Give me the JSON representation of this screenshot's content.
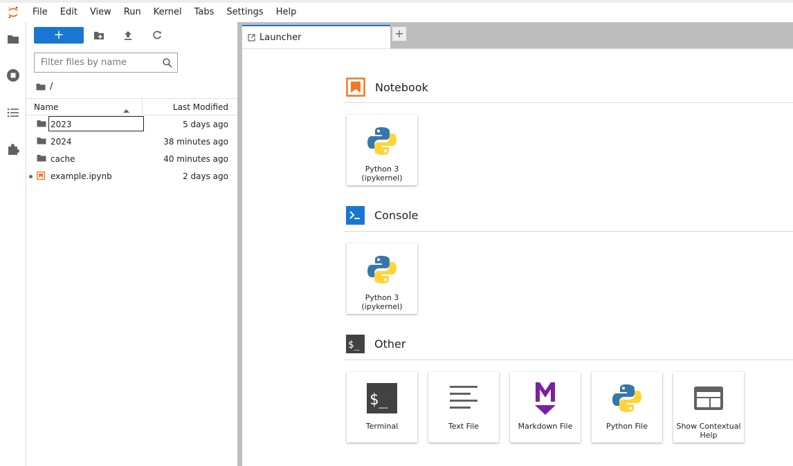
{
  "menubar": {
    "items": [
      "File",
      "Edit",
      "View",
      "Run",
      "Kernel",
      "Tabs",
      "Settings",
      "Help"
    ]
  },
  "activitybar": {
    "icons": [
      "folder-icon",
      "stop-circle-icon",
      "list-icon",
      "puzzle-icon"
    ]
  },
  "filebrowser": {
    "new_button": "+",
    "filter_placeholder": "Filter files by name",
    "breadcrumb": "/",
    "columns": {
      "name": "Name",
      "modified": "Last Modified"
    },
    "rows": [
      {
        "name": "2023",
        "modified": "5 days ago",
        "type": "folder",
        "editing": true
      },
      {
        "name": "2024",
        "modified": "38 minutes ago",
        "type": "folder"
      },
      {
        "name": "cache",
        "modified": "40 minutes ago",
        "type": "folder"
      },
      {
        "name": "example.ipynb",
        "modified": "2 days ago",
        "type": "notebook",
        "running": true
      }
    ]
  },
  "tabs": {
    "active": "Launcher",
    "add": "+"
  },
  "launcher": {
    "sections": [
      {
        "title": "Notebook",
        "cards": [
          {
            "label": "Python 3 (ipykernel)"
          }
        ]
      },
      {
        "title": "Console",
        "cards": [
          {
            "label": "Python 3 (ipykernel)"
          }
        ]
      },
      {
        "title": "Other",
        "cards": [
          {
            "label": "Terminal"
          },
          {
            "label": "Text File"
          },
          {
            "label": "Markdown File"
          },
          {
            "label": "Python File"
          },
          {
            "label": "Show Contextual Help"
          }
        ]
      }
    ]
  },
  "colors": {
    "accent": "#1976d2",
    "notebook_orange": "#f37726",
    "markdown_purple": "#7b1fa2",
    "running_green": "#388e3c"
  }
}
